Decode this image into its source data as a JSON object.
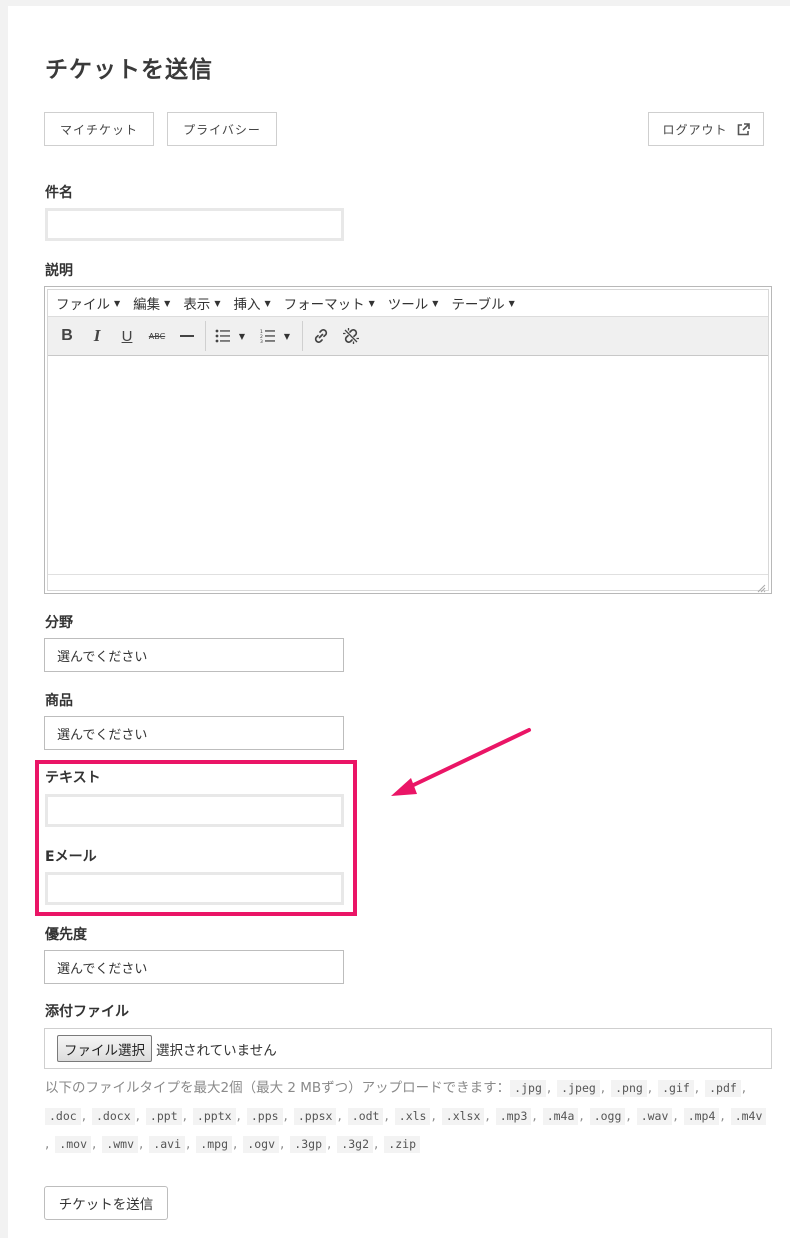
{
  "page": {
    "title": "チケットを送信"
  },
  "nav": {
    "my_tickets": "マイチケット",
    "privacy": "プライバシー",
    "logout": "ログアウト",
    "logout_icon": "external-link-icon"
  },
  "form": {
    "subject": {
      "label": "件名",
      "value": ""
    },
    "description": {
      "label": "説明",
      "menu": [
        "ファイル",
        "編集",
        "表示",
        "挿入",
        "フォーマット",
        "ツール",
        "テーブル"
      ],
      "toolbar": [
        "bold-icon",
        "italic-icon",
        "underline-icon",
        "strikethrough-icon",
        "horizontal-rule-icon",
        "bullet-list-icon",
        "numbered-list-icon",
        "link-icon",
        "unlink-icon"
      ],
      "bold_glyph": "B",
      "italic_glyph": "I",
      "underline_glyph": "U",
      "strike_glyph": "ABC"
    },
    "category": {
      "label": "分野",
      "value": "選んでください"
    },
    "product": {
      "label": "商品",
      "value": "選んでください"
    },
    "text": {
      "label": "テキスト",
      "value": ""
    },
    "email": {
      "label": "Eメール",
      "value": ""
    },
    "priority": {
      "label": "優先度",
      "value": "選んでください"
    },
    "attachment": {
      "label": "添付ファイル",
      "button": "ファイル選択",
      "status": "選択されていません",
      "note": "以下のファイルタイプを最大2個（最大 2 MBずつ）アップロードできます：",
      "extensions": [
        ".jpg",
        ".jpeg",
        ".png",
        ".gif",
        ".pdf",
        ".doc",
        ".docx",
        ".ppt",
        ".pptx",
        ".pps",
        ".ppsx",
        ".odt",
        ".xls",
        ".xlsx",
        ".mp3",
        ".m4a",
        ".ogg",
        ".wav",
        ".mp4",
        ".m4v",
        ".mov",
        ".wmv",
        ".avi",
        ".mpg",
        ".ogv",
        ".3gp",
        ".3g2",
        ".zip"
      ]
    },
    "submit": "チケットを送信"
  },
  "annotation": {
    "highlight_color": "#ea1566"
  }
}
